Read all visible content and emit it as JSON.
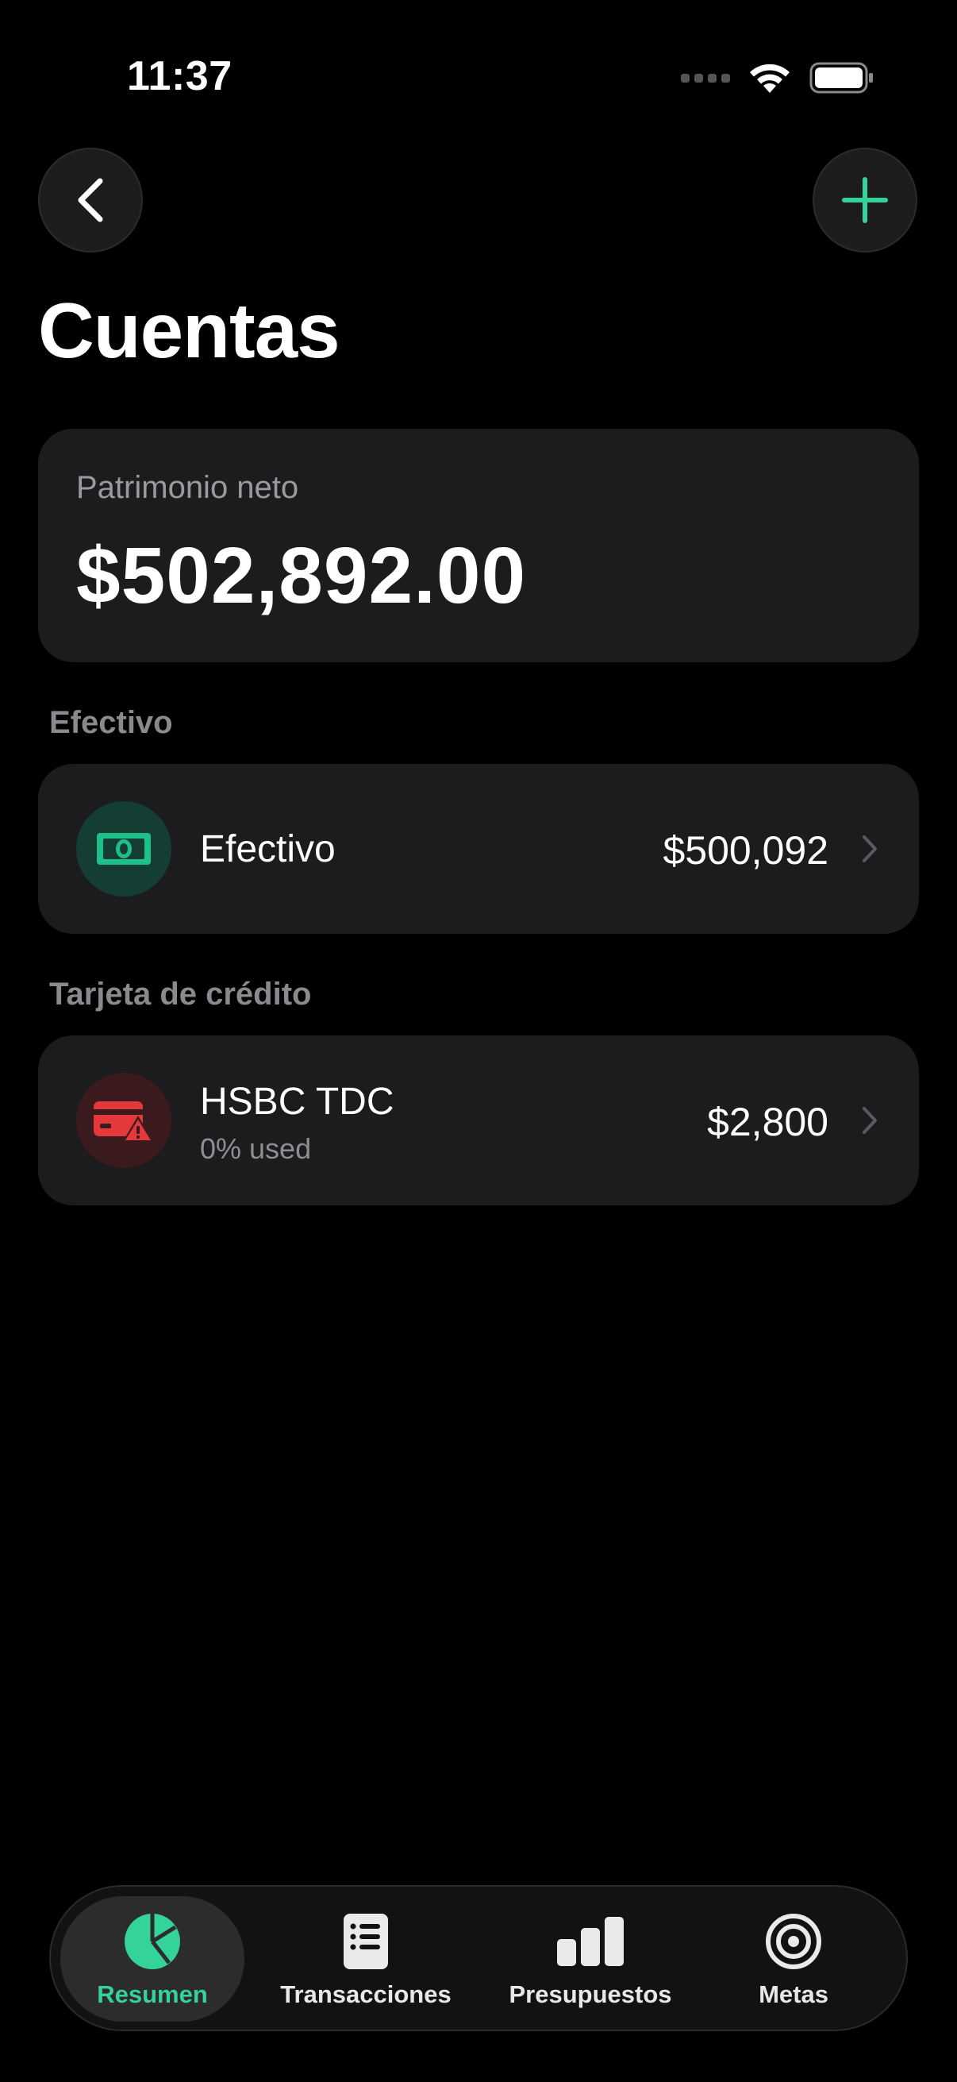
{
  "status_bar": {
    "time": "11:37"
  },
  "header": {
    "title": "Cuentas",
    "back_icon": "chevron-left-icon",
    "add_icon": "plus-icon"
  },
  "net_worth": {
    "label": "Patrimonio neto",
    "value": "$502,892.00"
  },
  "sections": [
    {
      "title": "Efectivo",
      "accounts": [
        {
          "name": "Efectivo",
          "amount": "$500,092",
          "icon": "banknote-icon"
        }
      ]
    },
    {
      "title": "Tarjeta de crédito",
      "accounts": [
        {
          "name": "HSBC TDC",
          "subtitle": "0% used",
          "amount": "$2,800",
          "icon": "credit-card-warning-icon"
        }
      ]
    }
  ],
  "tabbar": {
    "items": [
      {
        "label": "Resumen",
        "icon": "pie-chart-icon",
        "active": true
      },
      {
        "label": "Transacciones",
        "icon": "list-icon",
        "active": false
      },
      {
        "label": "Presupuestos",
        "icon": "bar-chart-icon",
        "active": false
      },
      {
        "label": "Metas",
        "icon": "target-icon",
        "active": false
      }
    ]
  },
  "colors": {
    "accent": "#34d399",
    "danger": "#e5383b",
    "card": "#1c1c1e",
    "background": "#000000"
  }
}
